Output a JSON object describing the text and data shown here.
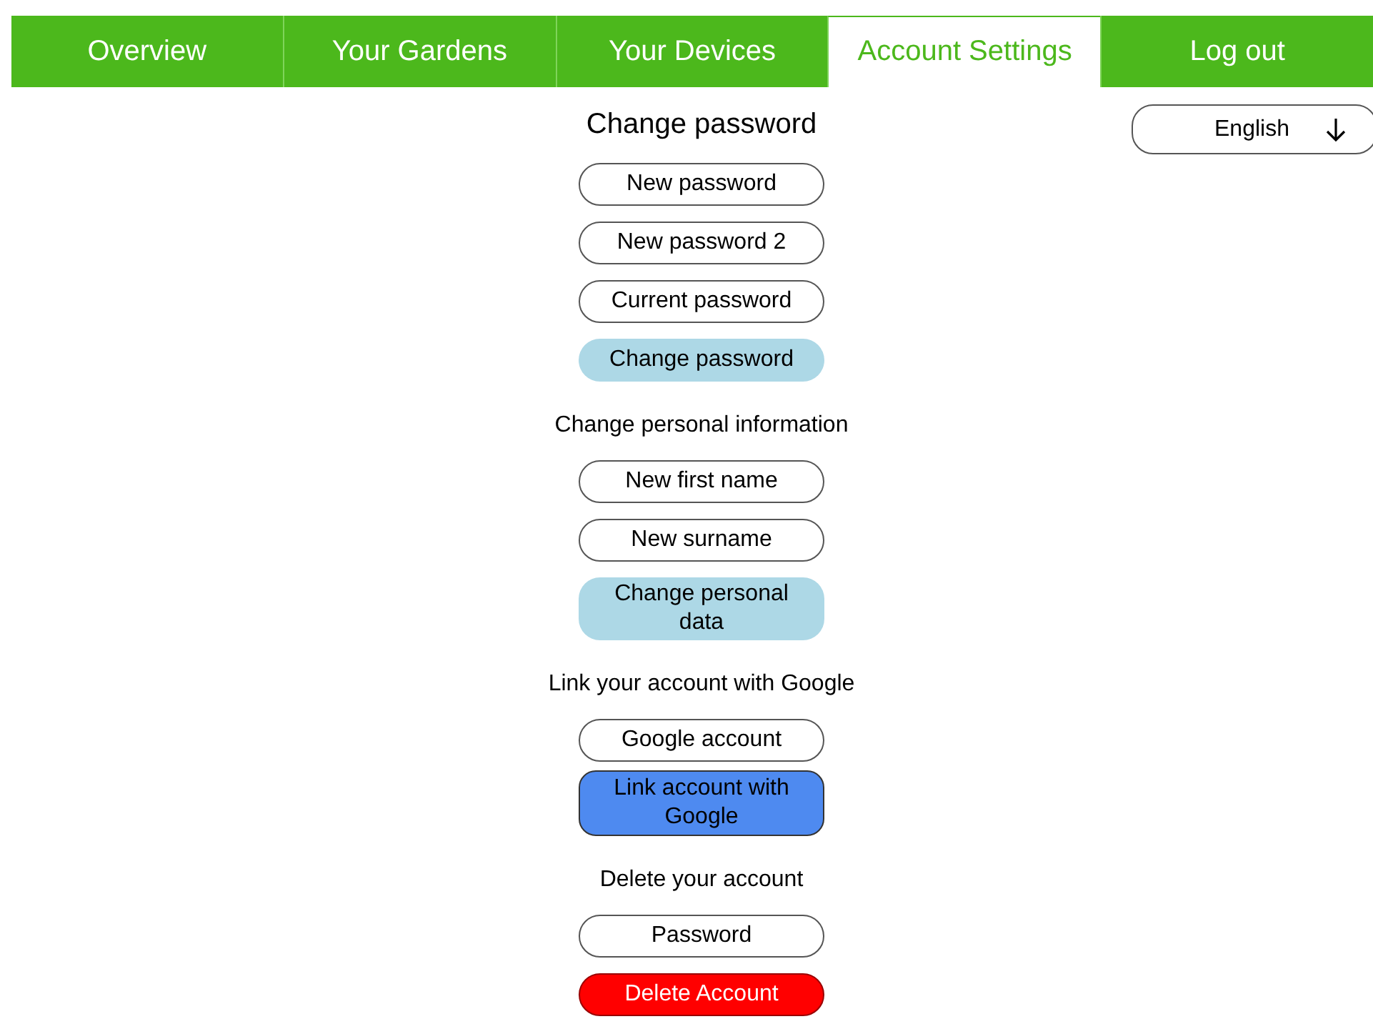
{
  "nav": {
    "tabs": [
      {
        "label": "Overview",
        "selected": false
      },
      {
        "label": "Your Gardens",
        "selected": false
      },
      {
        "label": "Your Devices",
        "selected": false
      },
      {
        "label": "Account Settings",
        "selected": true
      },
      {
        "label": "Log out",
        "selected": false
      }
    ]
  },
  "language": {
    "value": "English"
  },
  "sections": [
    {
      "title": "Change password",
      "kind": "main",
      "items": [
        {
          "kind": "field",
          "placeholder": "New password"
        },
        {
          "kind": "field",
          "placeholder": "New password 2"
        },
        {
          "kind": "field",
          "placeholder": "Current password"
        },
        {
          "kind": "action",
          "label": "Change password"
        }
      ]
    },
    {
      "title": "Change personal information",
      "kind": "sub",
      "items": [
        {
          "kind": "field",
          "placeholder": "New first name"
        },
        {
          "kind": "field",
          "placeholder": "New surname"
        },
        {
          "kind": "action",
          "label": "Change personal data"
        }
      ]
    },
    {
      "title": "Link your account with Google",
      "kind": "sub",
      "items": [
        {
          "kind": "field",
          "placeholder": "Google account"
        },
        {
          "kind": "link",
          "label": "Link account with Google"
        }
      ]
    },
    {
      "title": "Delete your account",
      "kind": "sub",
      "items": [
        {
          "kind": "field",
          "placeholder": "Password"
        },
        {
          "kind": "danger",
          "label": "Delete Account"
        }
      ]
    }
  ]
}
